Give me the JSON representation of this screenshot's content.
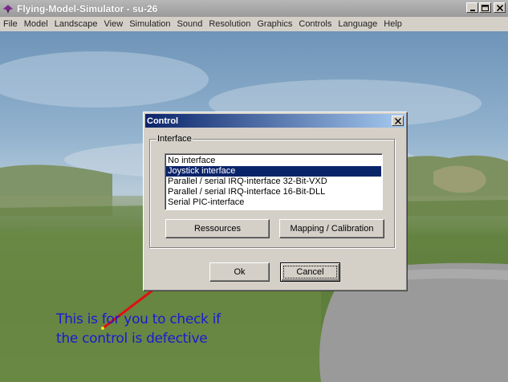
{
  "window": {
    "title": "Flying-Model-Simulator - su-26",
    "icons": [
      "app-icon",
      "minimize-icon",
      "maximize-icon",
      "close-icon"
    ]
  },
  "menu": {
    "items": [
      "File",
      "Model",
      "Landscape",
      "View",
      "Simulation",
      "Sound",
      "Resolution",
      "Graphics",
      "Controls",
      "Language",
      "Help"
    ]
  },
  "dialog": {
    "title": "Control",
    "group_label": "Interface",
    "list": {
      "items": [
        "No interface",
        "Joystick interface",
        "Parallel / serial IRQ-interface 32-Bit-VXD",
        "Parallel / serial IRQ-interface 16-Bit-DLL",
        "Serial PIC-interface"
      ],
      "selected_index": 1
    },
    "buttons": {
      "resources": "Ressources",
      "mapping": "Mapping / Calibration",
      "ok": "Ok",
      "cancel": "Cancel"
    }
  },
  "annotation": {
    "line1": "This is for you to check if",
    "line2": "the control is defective",
    "color": "#1a1ad0",
    "arrow_color": "#e01010"
  }
}
